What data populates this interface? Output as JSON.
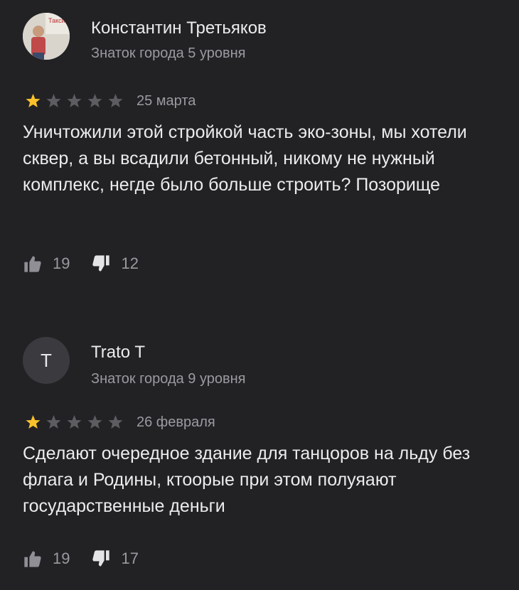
{
  "reviews": [
    {
      "author": "Константин Третьяков",
      "level": "Знаток города 5 уровня",
      "rating": 1,
      "date": "25 марта",
      "text": "Уничтожили этой стройкой часть эко-зоны, мы хотели сквер, а вы всадили бетонный, никому не нужный комплекс, негде было больше строить? Позорище",
      "likes": "19",
      "dislikes": "12"
    },
    {
      "author": "Trato T",
      "avatar_letter": "T",
      "level": "Знаток города 9 уровня",
      "rating": 1,
      "date": "26 февраля",
      "text": "Сделают очередное здание для танцоров на льду без флага и Родины, ктоорые при этом полуяают государственные деньги",
      "likes": "19",
      "dislikes": "17"
    }
  ],
  "colors": {
    "background": "#222225",
    "star_filled": "#fcc22b",
    "star_empty": "#5c5c61"
  },
  "icons": [
    "thumb-up-icon",
    "thumb-down-icon",
    "star-icon"
  ]
}
